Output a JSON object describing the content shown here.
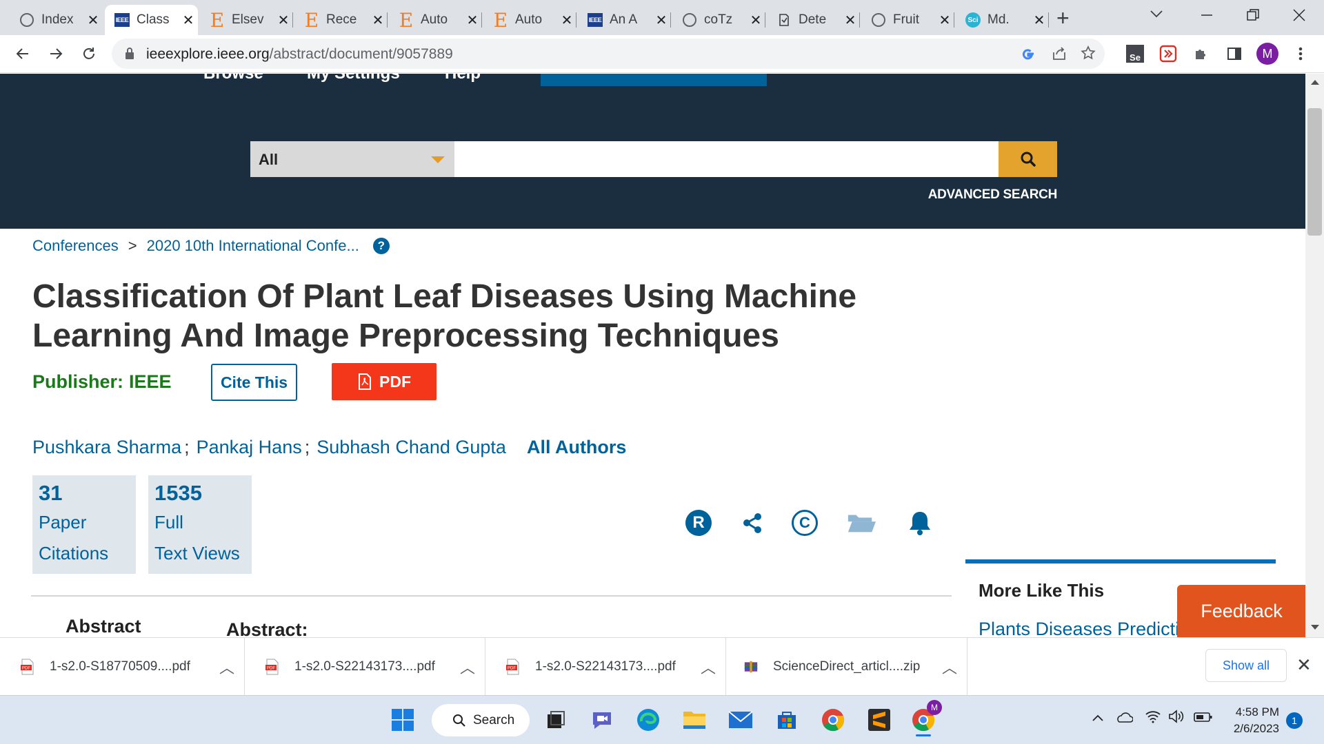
{
  "browser": {
    "tabs": [
      {
        "title": "Index",
        "favicon": "globe-icon"
      },
      {
        "title": "Class",
        "favicon": "ieee-icon",
        "active": true
      },
      {
        "title": "Elsev",
        "favicon": "elsevier-icon"
      },
      {
        "title": "Rece",
        "favicon": "elsevier-icon"
      },
      {
        "title": "Auto",
        "favicon": "elsevier-icon"
      },
      {
        "title": "Auto",
        "favicon": "elsevier-icon"
      },
      {
        "title": "An A",
        "favicon": "ieee-icon"
      },
      {
        "title": "coTz",
        "favicon": "globe-icon"
      },
      {
        "title": "Dete",
        "favicon": "doc-icon"
      },
      {
        "title": "Fruit",
        "favicon": "globe-icon"
      },
      {
        "title": "Md.",
        "favicon": "sci-icon"
      }
    ],
    "favicon_text": {
      "ieee": "IEEE",
      "elsevier": "E",
      "sci": "Sci"
    },
    "new_tab": "+",
    "url_host": "ieeexplore.ieee.org",
    "url_path": "/abstract/document/9057889",
    "profile_initial": "M",
    "ext_se_label": "Se"
  },
  "site": {
    "nav": [
      "Browse",
      "My Settings",
      "Help"
    ],
    "search_scope": "All",
    "search_placeholder": "",
    "advanced_search": "ADVANCED SEARCH",
    "colors": {
      "header_bg": "#1a2e3f",
      "link": "#00629b",
      "search_button": "#e4a32c",
      "pdf_button": "#f4361b"
    }
  },
  "document": {
    "breadcrumbs": [
      "Conferences",
      "2020 10th International Confe..."
    ],
    "breadcrumb_sep": ">",
    "help_glyph": "?",
    "title": "Classification Of Plant Leaf Diseases Using Machine Learning And Image Preprocessing Techniques",
    "publisher_label": "Publisher:",
    "publisher_value": "IEEE",
    "cite_label": "Cite This",
    "pdf_label": "PDF",
    "authors": [
      "Pushkara Sharma",
      "Pankaj Hans",
      "Subhash Chand Gupta"
    ],
    "author_sep": ";",
    "all_authors": "All Authors",
    "metrics": [
      {
        "value": "31",
        "label1": "Paper",
        "label2": "Citations"
      },
      {
        "value": "1535",
        "label1": "Full",
        "label2": "Text Views"
      }
    ],
    "actions": [
      "rights-icon",
      "share-icon",
      "copyright-icon",
      "folder-icon",
      "bell-icon"
    ],
    "action_glyphs": {
      "rights": "R",
      "copyright": "C"
    },
    "abstract_nav": "Abstract",
    "abstract_heading": "Abstract:"
  },
  "sidebar": {
    "more_like_this": "More Like This",
    "first_item": "Plants Diseases Prediction",
    "feedback": "Feedback"
  },
  "downloads": {
    "items": [
      {
        "name": "1-s2.0-S18770509....pdf",
        "type": "pdf"
      },
      {
        "name": "1-s2.0-S22143173....pdf",
        "type": "pdf"
      },
      {
        "name": "1-s2.0-S22143173....pdf",
        "type": "pdf"
      },
      {
        "name": "ScienceDirect_articl....zip",
        "type": "zip"
      }
    ],
    "pdf_badge": "PDF",
    "show_all": "Show all"
  },
  "taskbar": {
    "search_label": "Search",
    "profile_badge": "M",
    "time": "4:58 PM",
    "date": "2/6/2023",
    "notifications": "1"
  }
}
